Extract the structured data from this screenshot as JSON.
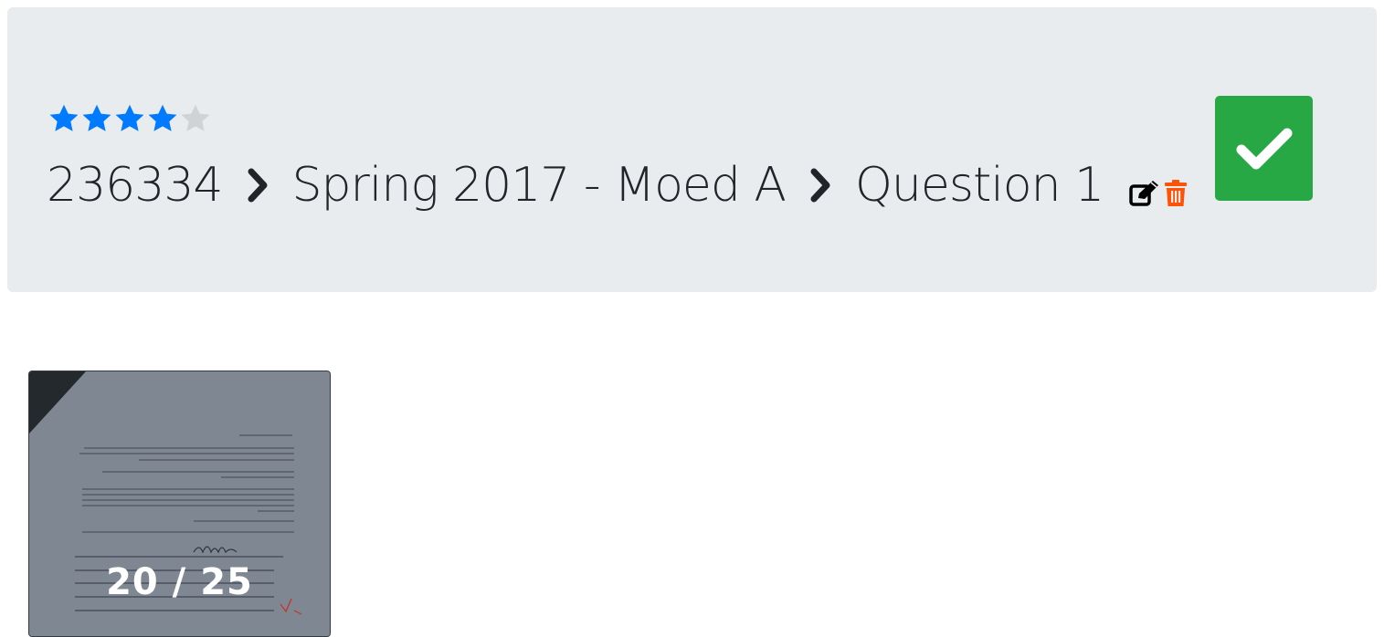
{
  "header": {
    "rating": {
      "value": 4,
      "max": 5,
      "filled_color": "#007bff",
      "empty_color": "#d0d3d6"
    },
    "breadcrumb": [
      {
        "label": "236334"
      },
      {
        "label": "Spring 2017 - Moed A"
      },
      {
        "label": "Question 1"
      }
    ],
    "icons": {
      "separator": "chevron-right-icon",
      "edit": "edit-icon",
      "delete": "trash-icon",
      "done": "check-icon"
    },
    "colors": {
      "done_button": "#28a745",
      "delete_icon": "#fd5308"
    }
  },
  "submission": {
    "grade_text": "20 / 25",
    "thumbnail": "exam-page-thumbnail"
  }
}
